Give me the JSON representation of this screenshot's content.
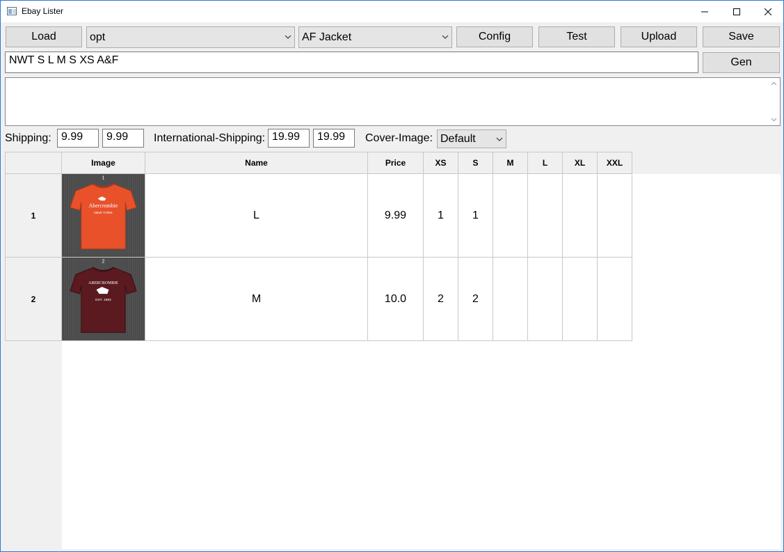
{
  "window": {
    "title": "Ebay Lister"
  },
  "toolbar": {
    "load_label": "Load",
    "option_select": "opt",
    "template_select": "AF Jacket",
    "config_label": "Config",
    "test_label": "Test",
    "upload_label": "Upload",
    "save_label": "Save",
    "gen_label": "Gen"
  },
  "title_input": {
    "value": "NWT S L M S XS A&F"
  },
  "description": {
    "value": ""
  },
  "shipping": {
    "label": "Shipping:",
    "value1": "9.99",
    "value2": "9.99",
    "intl_label": "International-Shipping:",
    "intl_value1": "19.99",
    "intl_value2": "19.99",
    "cover_label": "Cover-Image:",
    "cover_value": "Default"
  },
  "table": {
    "columns": [
      "Image",
      "Name",
      "Price",
      "XS",
      "S",
      "M",
      "L",
      "XL",
      "XXL"
    ],
    "rows": [
      {
        "index": "1",
        "image_number": "1",
        "shirt_color": "#e8512a",
        "brand_text": "Abercrombie",
        "sub_text": "NEW YORK",
        "name": "L",
        "price": "9.99",
        "xs": "1",
        "s": "1",
        "m": "",
        "l": "",
        "xl": "",
        "xxl": ""
      },
      {
        "index": "2",
        "image_number": "2",
        "shirt_color": "#5a1a1f",
        "brand_text": "ABERCROMBIE",
        "sub_text": "EST. 1892",
        "name": "M",
        "price": "10.0",
        "xs": "2",
        "s": "2",
        "m": "",
        "l": "",
        "xl": "",
        "xxl": ""
      }
    ]
  }
}
